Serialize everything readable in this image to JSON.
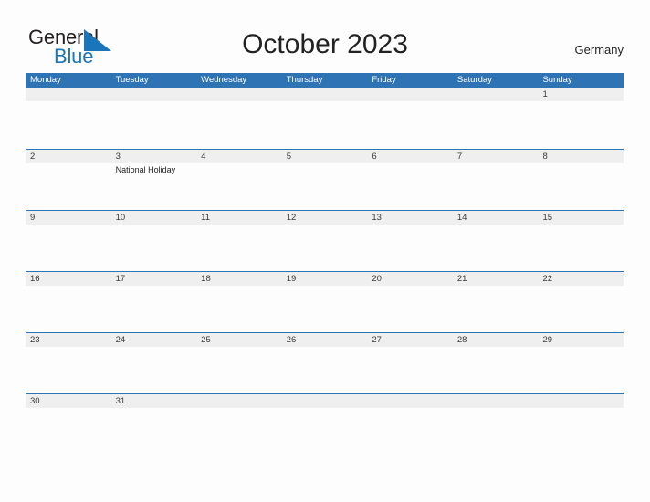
{
  "brand": {
    "word_general": "General",
    "word_blue": "Blue",
    "flag_color": "#1b75bb"
  },
  "header": {
    "title": "October 2023",
    "country": "Germany"
  },
  "calendar": {
    "accent_color": "#2e74b5",
    "band_color": "#efefef",
    "weekdays": [
      "Monday",
      "Tuesday",
      "Wednesday",
      "Thursday",
      "Friday",
      "Saturday",
      "Sunday"
    ],
    "weeks": [
      {
        "days": [
          {
            "number": "",
            "events": []
          },
          {
            "number": "",
            "events": []
          },
          {
            "number": "",
            "events": []
          },
          {
            "number": "",
            "events": []
          },
          {
            "number": "",
            "events": []
          },
          {
            "number": "",
            "events": []
          },
          {
            "number": "1",
            "events": []
          }
        ]
      },
      {
        "days": [
          {
            "number": "2",
            "events": []
          },
          {
            "number": "3",
            "events": [
              "National Holiday"
            ]
          },
          {
            "number": "4",
            "events": []
          },
          {
            "number": "5",
            "events": []
          },
          {
            "number": "6",
            "events": []
          },
          {
            "number": "7",
            "events": []
          },
          {
            "number": "8",
            "events": []
          }
        ]
      },
      {
        "days": [
          {
            "number": "9",
            "events": []
          },
          {
            "number": "10",
            "events": []
          },
          {
            "number": "11",
            "events": []
          },
          {
            "number": "12",
            "events": []
          },
          {
            "number": "13",
            "events": []
          },
          {
            "number": "14",
            "events": []
          },
          {
            "number": "15",
            "events": []
          }
        ]
      },
      {
        "days": [
          {
            "number": "16",
            "events": []
          },
          {
            "number": "17",
            "events": []
          },
          {
            "number": "18",
            "events": []
          },
          {
            "number": "19",
            "events": []
          },
          {
            "number": "20",
            "events": []
          },
          {
            "number": "21",
            "events": []
          },
          {
            "number": "22",
            "events": []
          }
        ]
      },
      {
        "days": [
          {
            "number": "23",
            "events": []
          },
          {
            "number": "24",
            "events": []
          },
          {
            "number": "25",
            "events": []
          },
          {
            "number": "26",
            "events": []
          },
          {
            "number": "27",
            "events": []
          },
          {
            "number": "28",
            "events": []
          },
          {
            "number": "29",
            "events": []
          }
        ]
      },
      {
        "days": [
          {
            "number": "30",
            "events": []
          },
          {
            "number": "31",
            "events": []
          },
          {
            "number": "",
            "events": []
          },
          {
            "number": "",
            "events": []
          },
          {
            "number": "",
            "events": []
          },
          {
            "number": "",
            "events": []
          },
          {
            "number": "",
            "events": []
          }
        ]
      }
    ]
  }
}
